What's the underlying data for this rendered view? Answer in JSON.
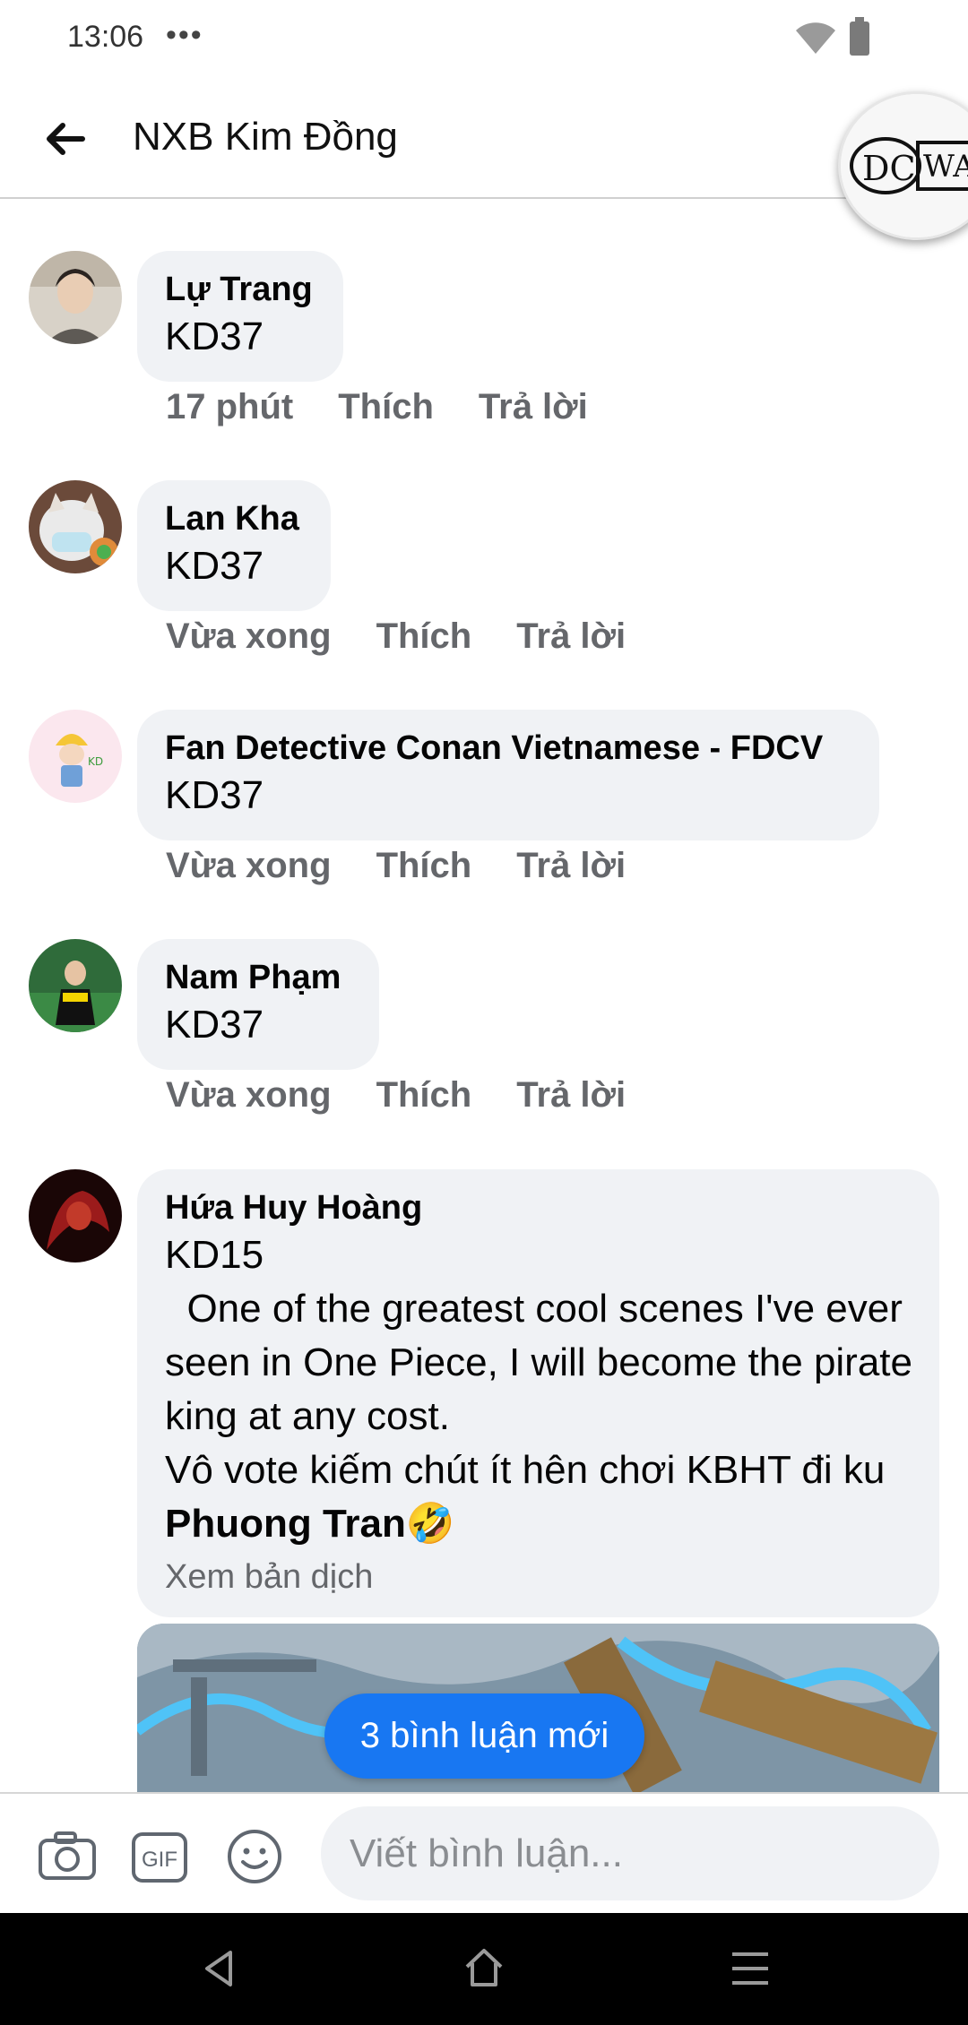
{
  "status_bar": {
    "time": "13:06",
    "dots": "•••"
  },
  "header": {
    "title": "NXB Kim Đồng",
    "badge_text": "DC WAO"
  },
  "comments": [
    {
      "name": "Lự Trang",
      "text": "KD37",
      "time": "17 phút",
      "like": "Thích",
      "reply": "Trả lời"
    },
    {
      "name": "Lan Kha",
      "text": "KD37",
      "time": "Vừa xong",
      "like": "Thích",
      "reply": "Trả lời"
    },
    {
      "name": "Fan Detective Conan Vietnamese - FDCV",
      "text": "KD37",
      "time": "Vừa xong",
      "like": "Thích",
      "reply": "Trả lời"
    },
    {
      "name": "Nam Phạm",
      "text": "KD37",
      "time": "Vừa xong",
      "like": "Thích",
      "reply": "Trả lời"
    },
    {
      "name": "Hứa Huy Hoàng",
      "line1": "KD15",
      "line2": "  One of the greatest cool scenes I've ever seen in One Piece, I will become the pirate king at any cost.",
      "line3": "Vô vote kiếm chút ít hên chơi KBHT đi ku ",
      "mention": "Phuong Tran",
      "emoji": "🤣",
      "see_translation": "Xem bản dịch"
    }
  ],
  "new_comments_button": "3 bình luận mới",
  "composer": {
    "placeholder": "Viết bình luận...",
    "gif_label": "GIF"
  },
  "colors": {
    "accent": "#1877f2",
    "bubble": "#f0f2f5",
    "meta": "#65676b"
  }
}
